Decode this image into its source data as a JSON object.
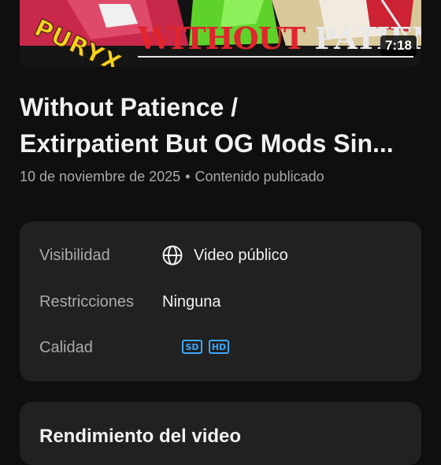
{
  "thumbnail": {
    "title_overlay_part1": "WITHOUT",
    "title_overlay_part2": "PATIENCE",
    "logo_text": "PURYX",
    "duration": "7:18"
  },
  "video": {
    "title_line1": "Without Patience /",
    "title_line2": "Extirpatient But OG Mods Sin...",
    "date": "10 de noviembre de 2025",
    "separator": "•",
    "status": "Contenido publicado"
  },
  "details": {
    "visibility_label": "Visibilidad",
    "visibility_value": "Video público",
    "restrictions_label": "Restricciones",
    "restrictions_value": "Ninguna",
    "quality_label": "Calidad",
    "quality_badges": [
      "SD",
      "HD"
    ]
  },
  "performance": {
    "title": "Rendimiento del video"
  },
  "colors": {
    "background": "#0f0f0f",
    "card": "#212121",
    "accent_blue": "#3ea6ff"
  }
}
